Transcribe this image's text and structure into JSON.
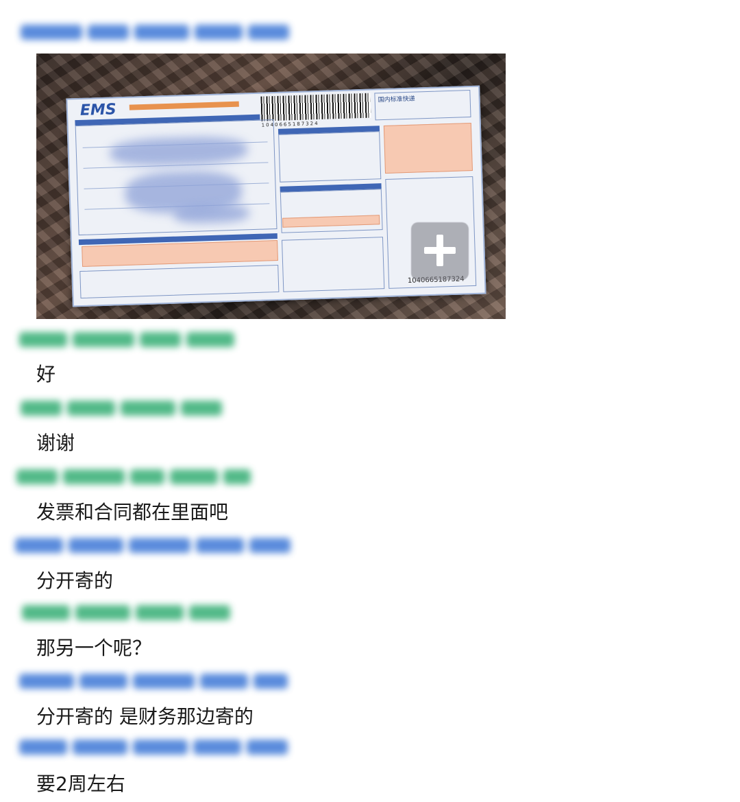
{
  "colors": {
    "sender_blue": "#3c77d6",
    "sender_green": "#34ad73",
    "text": "#1a1a1a"
  },
  "photo": {
    "carrier": "EMS",
    "form_title": "国内标准快递",
    "tracking_number": "1040665187324",
    "overlay_icon": "plus-icon"
  },
  "messages": [
    {
      "sender_color": "green",
      "text": "好"
    },
    {
      "sender_color": "green",
      "text": "谢谢"
    },
    {
      "sender_color": "green",
      "text": "发票和合同都在里面吧"
    },
    {
      "sender_color": "blue",
      "text": "分开寄的"
    },
    {
      "sender_color": "green",
      "text": "那另一个呢？"
    },
    {
      "sender_color": "blue",
      "text": "分开寄的 是财务那边寄的"
    },
    {
      "sender_color": "blue",
      "text": "要2周左右"
    }
  ]
}
